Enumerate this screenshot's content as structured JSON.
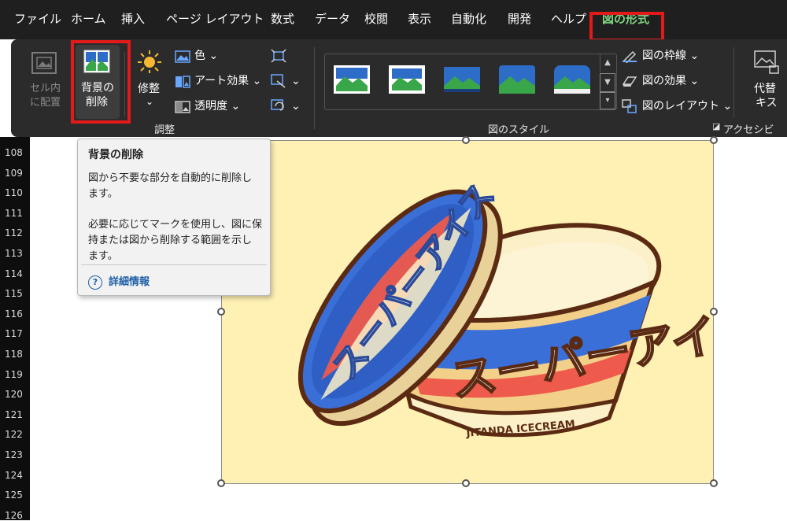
{
  "menu": {
    "tabs": [
      {
        "label": "ファイル"
      },
      {
        "label": "ホーム"
      },
      {
        "label": "挿入"
      },
      {
        "label": "ページ レイアウト"
      },
      {
        "label": "数式"
      },
      {
        "label": "データ"
      },
      {
        "label": "校閲"
      },
      {
        "label": "表示"
      },
      {
        "label": "自動化"
      },
      {
        "label": "開発"
      },
      {
        "label": "ヘルプ"
      },
      {
        "label": "図の形式"
      }
    ],
    "active_tab": "図の形式"
  },
  "ribbon": {
    "fit_cell": {
      "line1": "セル内",
      "line2": "に配置"
    },
    "remove_bg": {
      "line1": "背景の",
      "line2": "削除"
    },
    "corrections": {
      "label": "修整",
      "chevron": "⌄"
    },
    "color": {
      "label": "色 ⌄"
    },
    "artistic": {
      "label": "アート効果 ⌄"
    },
    "transparency": {
      "label": "透明度 ⌄"
    },
    "adjust_group": "調整",
    "picture_styles_group": "図のスタイル",
    "border": {
      "label": "図の枠線 ⌄"
    },
    "effects": {
      "label": "図の効果 ⌄"
    },
    "layout": {
      "label": "図のレイアウト ⌄"
    },
    "alt_text": {
      "line1": "代替",
      "line2": "キス"
    },
    "accessibility_group": "アクセシビ"
  },
  "tooltip": {
    "title": "背景の削除",
    "para1_line1": "図から不要な部分を自動的に削除し",
    "para1_line2": "ます。",
    "para2_line1": "必要に応じてマークを使用し、図に保",
    "para2_line2": "持または図から削除する範囲を示し",
    "para2_line3": "ます。",
    "help_icon": "?",
    "help_link": "詳細情報"
  },
  "rows": [
    "108",
    "109",
    "110",
    "111",
    "112",
    "113",
    "114",
    "115",
    "116",
    "117",
    "118",
    "119",
    "120",
    "121",
    "122",
    "123",
    "124",
    "125",
    "126"
  ],
  "picture": {
    "lid_text": "スーパーアイス",
    "cup_text": "スーパーアイス",
    "brand_text": "JITANDA ICECREAM"
  },
  "colors": {
    "active_tab": "#7fd37f",
    "highlight": "#e21a1a",
    "picture_bg": "#fff0b3",
    "lid_blue": "#3a6fd8",
    "stripe_red": "#ee5a4c",
    "cream": "#fbf0c8"
  }
}
